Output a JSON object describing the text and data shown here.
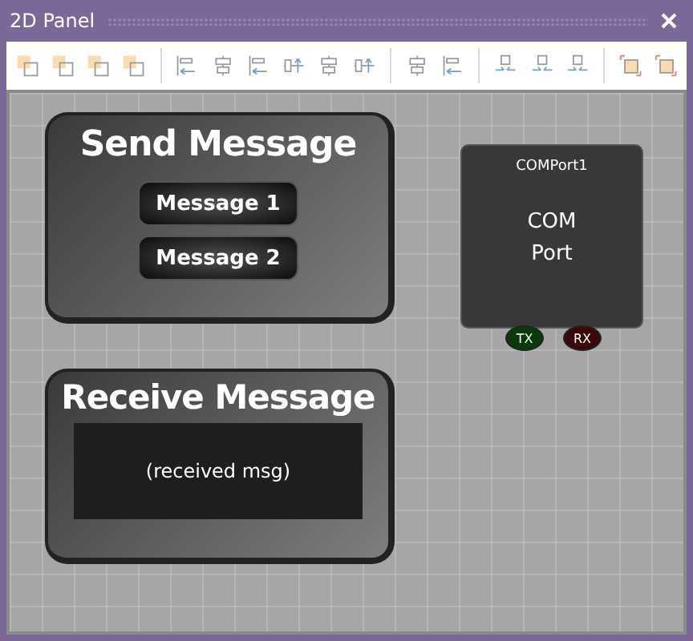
{
  "window": {
    "title": "2D Panel"
  },
  "canvas": {
    "send_panel": {
      "title": "Send Message",
      "buttons": [
        "Message 1",
        "Message 2"
      ]
    },
    "receive_panel": {
      "title": "Receive Message",
      "display": "(received msg)"
    },
    "com_port": {
      "name": "COMPort1",
      "label": "COM\nPort",
      "pins": [
        {
          "label": "TX",
          "color": "#0a3a0a"
        },
        {
          "label": "RX",
          "color": "#3a0808"
        }
      ]
    }
  }
}
